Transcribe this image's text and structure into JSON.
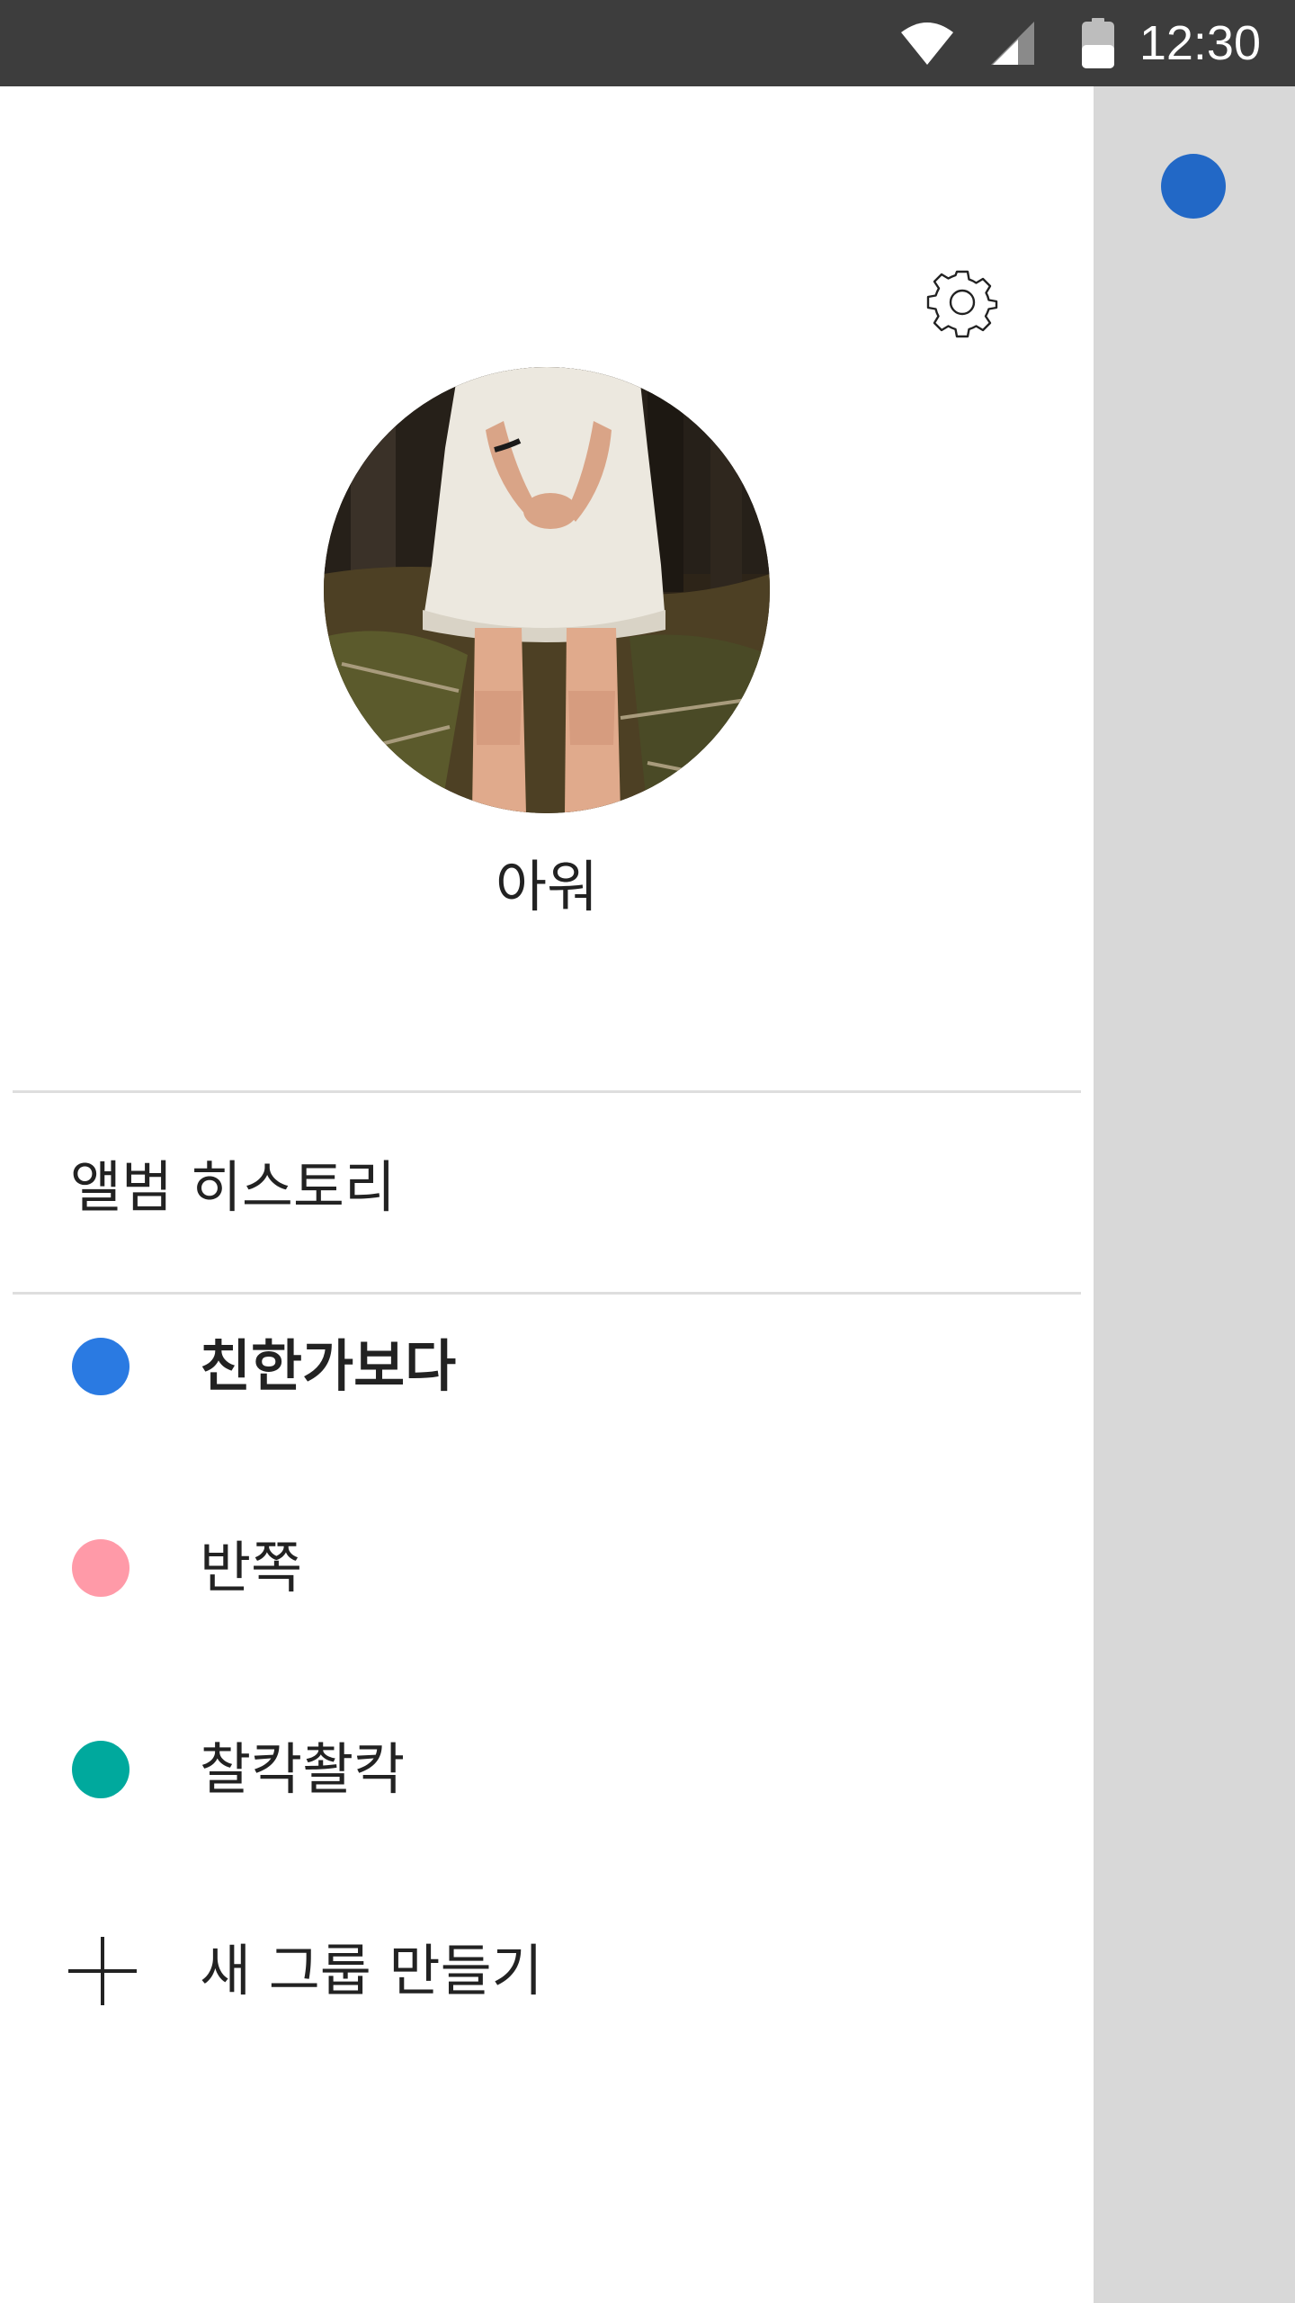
{
  "status_bar": {
    "time": "12:30",
    "icons": [
      "wifi-icon",
      "cell-signal-icon",
      "battery-icon"
    ]
  },
  "drawer": {
    "settings_icon": "gear-icon",
    "profile": {
      "name": "아워"
    },
    "history_label": "앨범 히스토리",
    "groups": [
      {
        "label": "친한가보다",
        "color": "#2a7ae2",
        "active": true
      },
      {
        "label": "반쪽",
        "color": "#ff9aa8",
        "active": false
      },
      {
        "label": "찰칵촬칵",
        "color": "#00a99d",
        "active": false
      }
    ],
    "new_group_label": "새 그룹 만들기",
    "new_group_icon": "plus-icon"
  },
  "scrim": {
    "dot_color": "#2268c6"
  }
}
